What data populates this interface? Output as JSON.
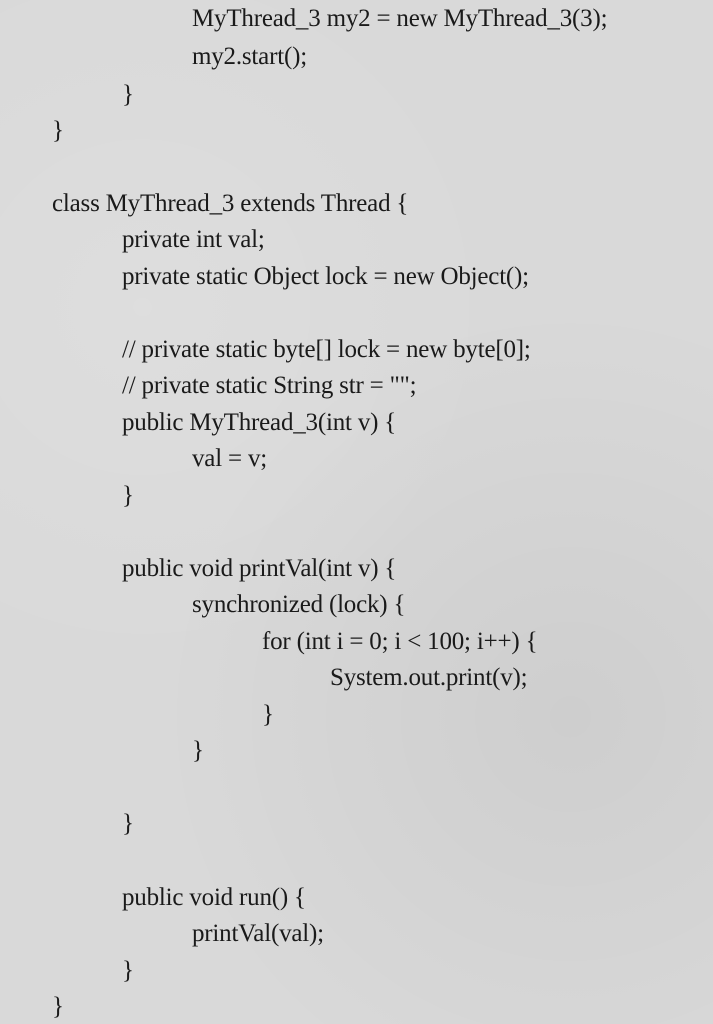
{
  "code_lines": [
    "MyThread_3 my2 = new MyThread_3(3);",
    "my2.start();",
    "}",
    "}",
    "class MyThread_3 extends Thread {",
    "private int val;",
    "private static Object lock = new Object();",
    "// private static byte[] lock = new byte[0];",
    "// private static String str = \"\";",
    "public MyThread_3(int v) {",
    "val = v;",
    "}",
    "public void printVal(int v) {",
    "synchronized (lock) {",
    "for (int i = 0; i < 100; i++) {",
    "System.out.print(v);",
    "}",
    "}",
    "}",
    "public void run() {",
    "printVal(val);",
    "}",
    "}"
  ]
}
